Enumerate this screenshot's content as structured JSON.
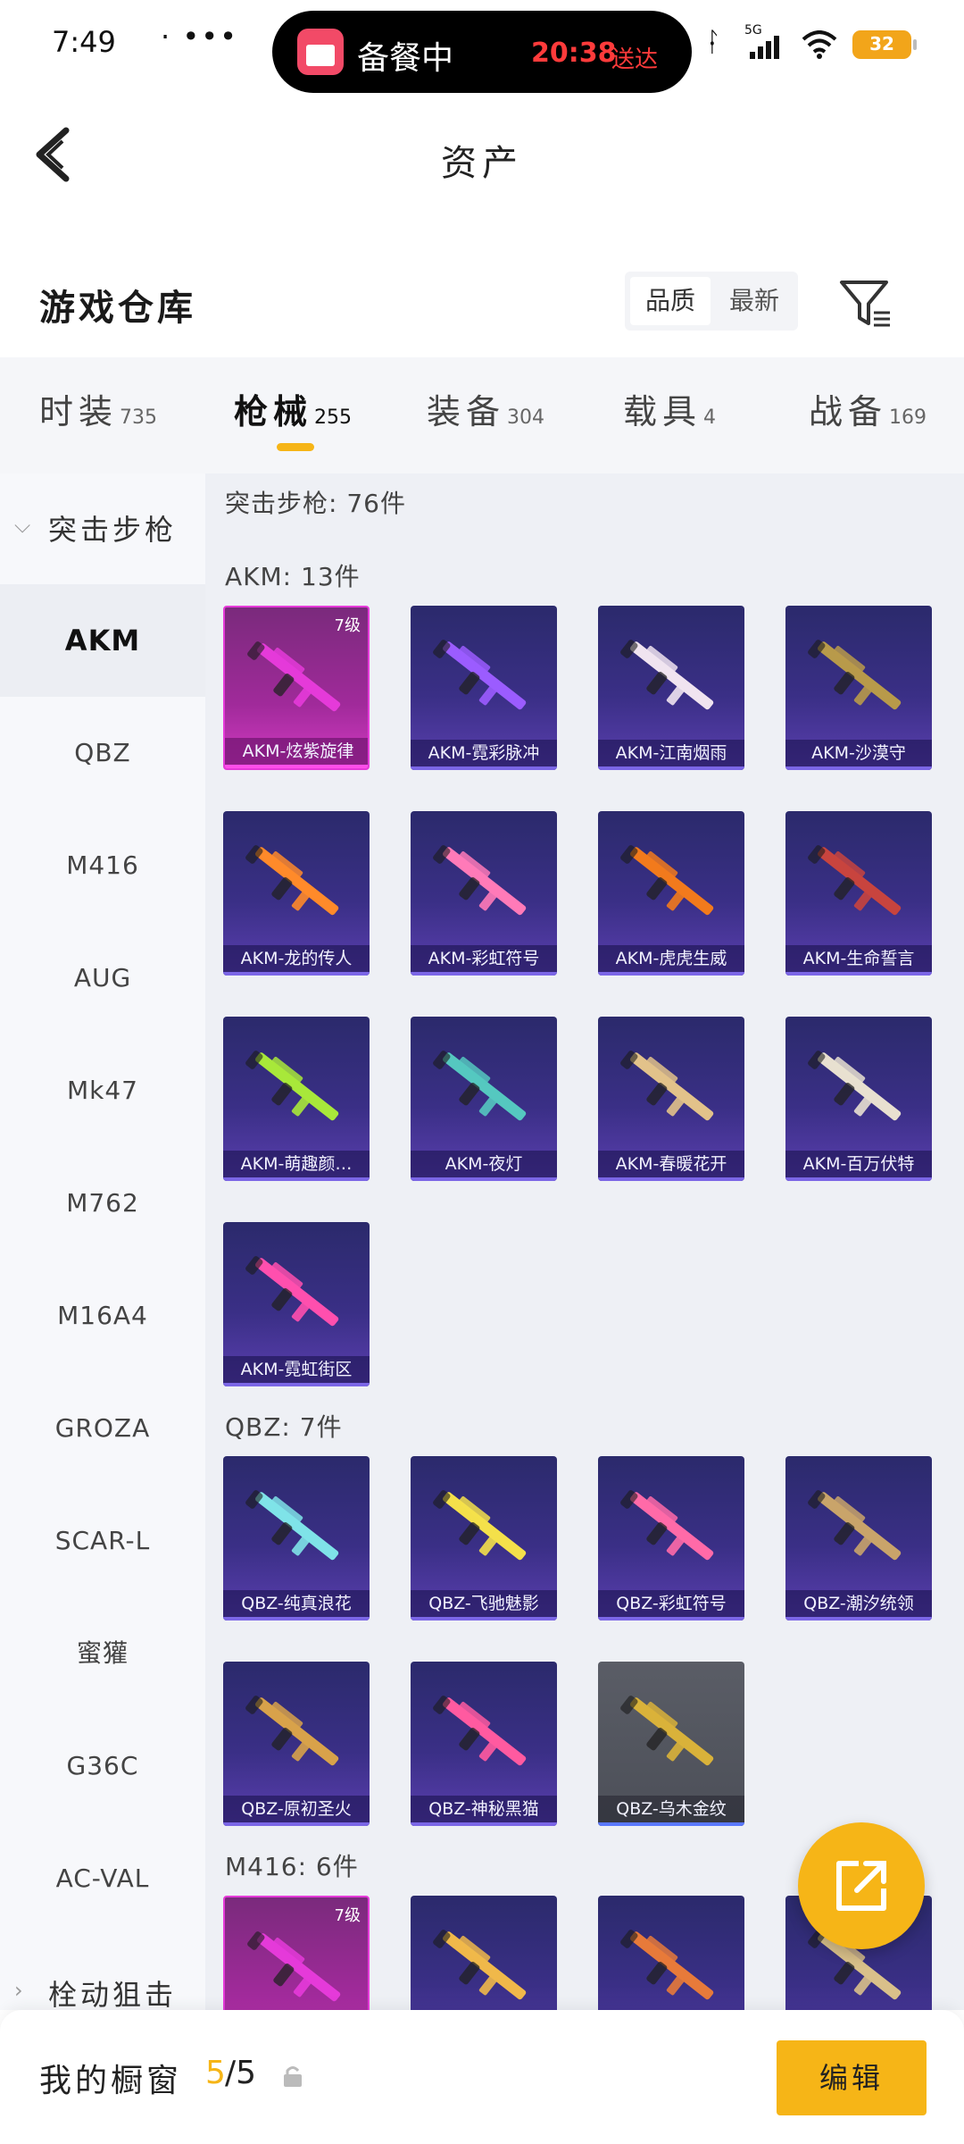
{
  "status_bar": {
    "time": "7:49",
    "dots": "· •••",
    "island_text": "备餐中",
    "island_eta": "20:38",
    "island_eta_suffix": "送达",
    "network_label": "5G",
    "battery": "32"
  },
  "nav": {
    "title": "资产"
  },
  "section": {
    "title": "游戏仓库",
    "sort_active": "品质",
    "sort_inactive": "最新"
  },
  "tabs": [
    {
      "label": "时装",
      "count": "735"
    },
    {
      "label": "枪械",
      "count": "255"
    },
    {
      "label": "装备",
      "count": "304"
    },
    {
      "label": "载具",
      "count": "4"
    },
    {
      "label": "战备",
      "count": "169"
    }
  ],
  "active_tab": 1,
  "sidebar": {
    "category_open": "突击步枪",
    "items": [
      "AKM",
      "QBZ",
      "M416",
      "AUG",
      "Mk47",
      "M762",
      "M16A4",
      "GROZA",
      "SCAR-L",
      "蜜獾",
      "G36C",
      "AC-VAL"
    ],
    "category_closed": "栓动狙击"
  },
  "content": {
    "category_summary": "突击步枪: 76件",
    "groups": [
      {
        "title": "AKM: 13件",
        "cards": [
          {
            "name": "AKM-炫紫旋律",
            "level": "7级",
            "accent": "#e53ad9"
          },
          {
            "name": "AKM-霓彩脉冲",
            "accent": "#9b5cff"
          },
          {
            "name": "AKM-江南烟雨",
            "accent": "#f0e4f0"
          },
          {
            "name": "AKM-沙漠守",
            "accent": "#b89a4a"
          },
          {
            "name": "AKM-龙的传人",
            "accent": "#ff8a2a"
          },
          {
            "name": "AKM-彩虹符号",
            "accent": "#ff7ab8"
          },
          {
            "name": "AKM-虎虎生威",
            "accent": "#f27a1c"
          },
          {
            "name": "AKM-生命誓言",
            "accent": "#c8443e"
          },
          {
            "name": "AKM-萌趣颜…",
            "accent": "#a8e83a"
          },
          {
            "name": "AKM-夜灯",
            "accent": "#55c8c0"
          },
          {
            "name": "AKM-春暖花开",
            "accent": "#e2c28a"
          },
          {
            "name": "AKM-百万伏特",
            "accent": "#e8e0d0"
          },
          {
            "name": "AKM-霓虹街区",
            "accent": "#ff4fae"
          }
        ]
      },
      {
        "title": "QBZ: 7件",
        "cards": [
          {
            "name": "QBZ-纯真浪花",
            "accent": "#7fe3e8"
          },
          {
            "name": "QBZ-飞驰魅影",
            "accent": "#f4e04a"
          },
          {
            "name": "QBZ-彩虹符号",
            "accent": "#ff6aa8"
          },
          {
            "name": "QBZ-潮汐统领",
            "accent": "#c9a46a"
          },
          {
            "name": "QBZ-原初圣火",
            "accent": "#d8a24a"
          },
          {
            "name": "QBZ-神秘黑猫",
            "accent": "#ff5aa0"
          },
          {
            "name": "QBZ-乌木金纹",
            "accent": "#d9b23a",
            "gray": true
          }
        ]
      },
      {
        "title": "M416: 6件",
        "cards": [
          {
            "name": "",
            "level": "7级",
            "accent": "#e53ad9"
          },
          {
            "name": "",
            "accent": "#f0b84a"
          },
          {
            "name": "",
            "accent": "#e77a3a"
          },
          {
            "name": "",
            "accent": "#d9c08a"
          }
        ]
      }
    ]
  },
  "bottom_bar": {
    "label": "我的橱窗",
    "used": "5",
    "total": "/5",
    "edit_label": "编辑"
  },
  "colors": {
    "accent": "#f6b517",
    "card_purple": "#3a2f86",
    "card_legendary": "#e53ad9"
  }
}
